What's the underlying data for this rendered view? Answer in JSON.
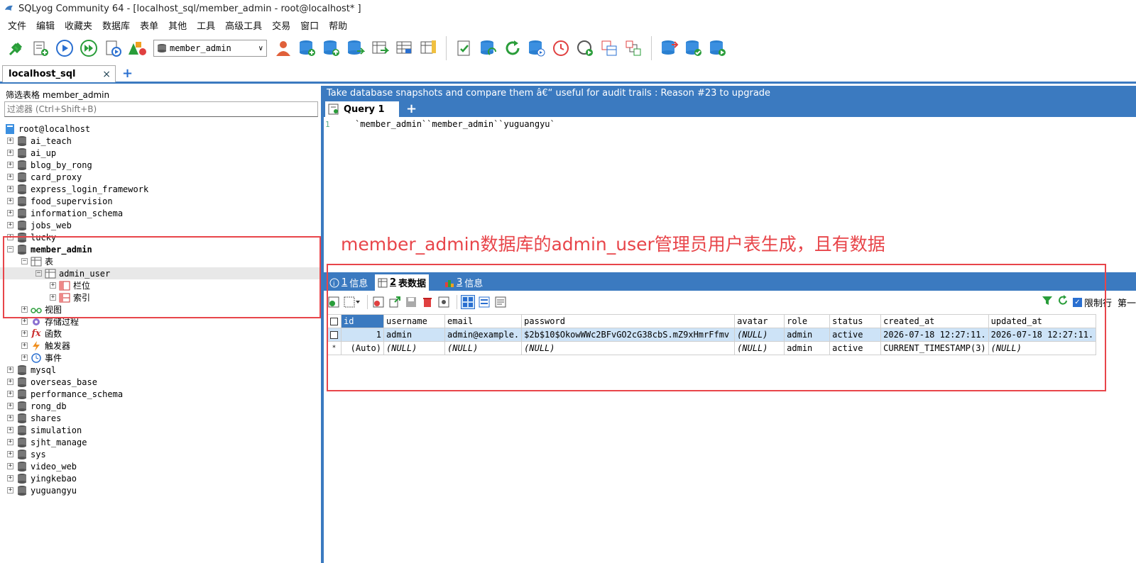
{
  "window": {
    "title": "SQLyog Community 64 - [localhost_sql/member_admin - root@localhost* ]"
  },
  "menu": [
    "文件",
    "编辑",
    "收藏夹",
    "数据库",
    "表单",
    "其他",
    "工具",
    "高级工具",
    "交易",
    "窗口",
    "帮助"
  ],
  "toolbar": {
    "db_select": "member_admin"
  },
  "connection_tab": {
    "label": "localhost_sql",
    "close": "×",
    "add": "+"
  },
  "left": {
    "filter_label": "筛选表格 member_admin",
    "filter_placeholder": "过滤器 (Ctrl+Shift+B)",
    "root": "root@localhost",
    "dbs_before": [
      "ai_teach",
      "ai_up",
      "blog_by_rong",
      "card_proxy",
      "express_login_framework",
      "food_supervision",
      "information_schema",
      "jobs_web",
      "lucky"
    ],
    "expanded_db": "member_admin",
    "tables_node": "表",
    "table": "admin_user",
    "columns_node": "栏位",
    "indexes_node": "索引",
    "views_node": "视图",
    "procs_node": "存储过程",
    "funcs_node": "函数",
    "triggers_node": "触发器",
    "events_node": "事件",
    "dbs_after": [
      "mysql",
      "overseas_base",
      "performance_schema",
      "rong_db",
      "shares",
      "simulation",
      "sjht_manage",
      "sys",
      "video_web",
      "yingkebao",
      "yuguangyu"
    ]
  },
  "right": {
    "promo": "Take database snapshots and compare them â€“ useful for audit trails : Reason #23 to upgrade",
    "query_tab": "Query 1",
    "add_query": "+",
    "line_no": "1",
    "code": "`member_admin``member_admin``yuguangyu`",
    "annotation": "member_admin数据库的admin_user管理员用户表生成，且有数据",
    "result_tabs": [
      {
        "num": "1",
        "label": "信息"
      },
      {
        "num": "2",
        "label": "表数据"
      },
      {
        "num": "3",
        "label": "信息"
      }
    ],
    "limit_label": "限制行",
    "first_label": "第一",
    "grid": {
      "columns": [
        "id",
        "username",
        "email",
        "password",
        "avatar",
        "role",
        "status",
        "created_at",
        "updated_at"
      ],
      "rows": [
        [
          "1",
          "admin",
          "admin@example.",
          "$2b$10$OkowWWc2BFvGO2cG38cbS.mZ9xHmrFfmv",
          "(NULL)",
          "admin",
          "active",
          "2026-07-18 12:27:11.",
          "2026-07-18 12:27:11."
        ],
        [
          "(Auto)",
          "(NULL)",
          "(NULL)",
          "(NULL)",
          "(NULL)",
          "admin",
          "active",
          "CURRENT_TIMESTAMP(3)",
          "(NULL)"
        ]
      ],
      "new_row_marker": "*"
    }
  },
  "colors": {
    "accent": "#3b7ac0",
    "annotation": "#e8454a",
    "selected_row": "#cde3f7"
  }
}
